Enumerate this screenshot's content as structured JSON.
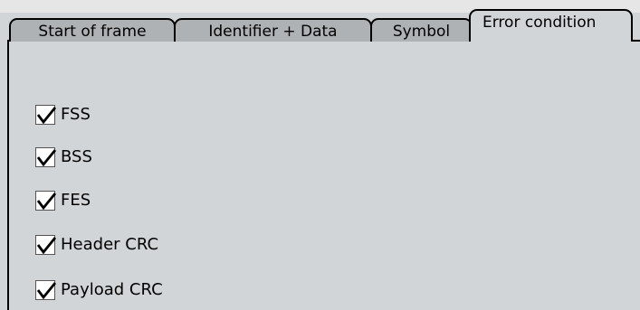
{
  "tabs": [
    {
      "label": "Start of frame"
    },
    {
      "label": "Identifier + Data"
    },
    {
      "label": "Symbol"
    },
    {
      "label": "Error condition",
      "active": true
    }
  ],
  "checkboxes": [
    {
      "label": "FSS",
      "checked": true
    },
    {
      "label": "BSS",
      "checked": true
    },
    {
      "label": "FES",
      "checked": true
    },
    {
      "label": "Header CRC",
      "checked": true
    },
    {
      "label": "Payload CRC",
      "checked": true
    }
  ],
  "colors": {
    "panel_background": "#d1d5d8",
    "inactive_tab": "#aeb2b5",
    "checkbox_fill": "#ffffff",
    "check_mark": "#000000"
  },
  "icons": {
    "check": "check-icon"
  }
}
